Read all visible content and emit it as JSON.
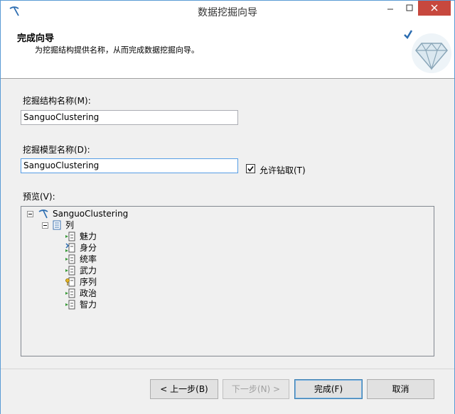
{
  "window": {
    "title": "数据挖掘向导"
  },
  "header": {
    "title": "完成向导",
    "subtitle": "为挖掘结构提供名称，从而完成数据挖掘向导。"
  },
  "form": {
    "structure_name_label": "挖掘结构名称(M):",
    "structure_name_value": "SanguoClustering",
    "model_name_label": "挖掘模型名称(D):",
    "model_name_value": "SanguoClustering",
    "allow_drillthrough_label": "允许钻取(T)",
    "allow_drillthrough_checked": true,
    "preview_label": "预览(V):"
  },
  "preview": {
    "root": {
      "label": "SanguoClustering",
      "icon": "mining-structure-icon"
    },
    "columns_node": {
      "label": "列",
      "icon": "table-icon"
    },
    "columns": [
      {
        "label": "魅力",
        "icon": "input-column-icon"
      },
      {
        "label": "身分",
        "icon": "predict-input-column-icon"
      },
      {
        "label": "统率",
        "icon": "input-column-icon"
      },
      {
        "label": "武力",
        "icon": "input-column-icon"
      },
      {
        "label": "序列",
        "icon": "key-column-icon"
      },
      {
        "label": "政治",
        "icon": "input-column-icon"
      },
      {
        "label": "智力",
        "icon": "input-column-icon"
      }
    ]
  },
  "footer": {
    "back_label": "< 上一步(B)",
    "next_label": "下一步(N) >",
    "finish_label": "完成(F)",
    "cancel_label": "取消"
  },
  "colors": {
    "accent": "#5a9bd5",
    "close": "#c7483e",
    "panel": "#f0f0f0"
  }
}
